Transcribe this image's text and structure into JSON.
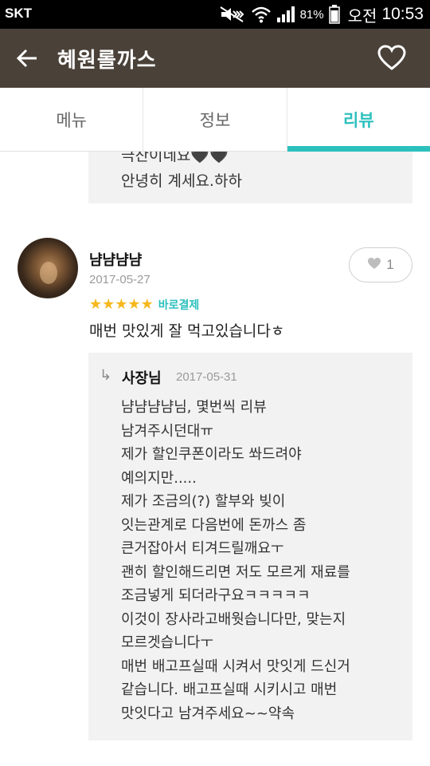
{
  "status_bar": {
    "carrier": "SKT",
    "battery": "81%",
    "ampm": "오전",
    "time": "10:53",
    "icons": [
      "mute-icon",
      "wifi-icon",
      "signal-icon",
      "battery-icon"
    ]
  },
  "app_bar": {
    "title": "혜원롤까스",
    "back_icon": "arrow-left-icon",
    "favorite_icon": "heart-outline-icon"
  },
  "tabs": [
    {
      "label": "메뉴",
      "active": false
    },
    {
      "label": "정보",
      "active": false
    },
    {
      "label": "리뷰",
      "active": true
    }
  ],
  "colors": {
    "accent": "#2cc0bd",
    "app_bar": "#4a4139",
    "star": "#f6b81c",
    "reply_bg": "#f2f2f2"
  },
  "previous_reply": {
    "lines": [
      "극찬이네요🖤🖤",
      "안녕히 계세요.하하"
    ]
  },
  "review": {
    "username": "냠냠냠냠",
    "date": "2017-05-27",
    "rating": 5,
    "badge": "바로결제",
    "like_count": "1",
    "text": "매번 맛있게 잘 먹고있습니다ㅎ",
    "owner_reply": {
      "name": "사장님",
      "date": "2017-05-31",
      "lines": [
        "냠냠냠냠님, 몇번씩 리뷰",
        "남겨주시던대ㅠ",
        "제가 할인쿠폰이라도 쏴드려야",
        "예의지만.....",
        "제가 조금의(?) 할부와 빚이",
        "잇는관계로 다음번에 돈까스 좀",
        "큰거잡아서 티겨드릴깨요ㅜ",
        "괜히 할인해드리면 저도 모르게 재료를",
        "조금넣게 되더라구요ㅋㅋㅋㅋㅋ",
        "이것이 장사라고배웟습니다만,  맞는지",
        "모르겟습니다ㅜ",
        "매번 배고프실때 시켜서 맛잇게 드신거",
        "같습니다. 배고프실때 시키시고 매번",
        "맛잇다고 남겨주세요~~약속"
      ]
    }
  }
}
